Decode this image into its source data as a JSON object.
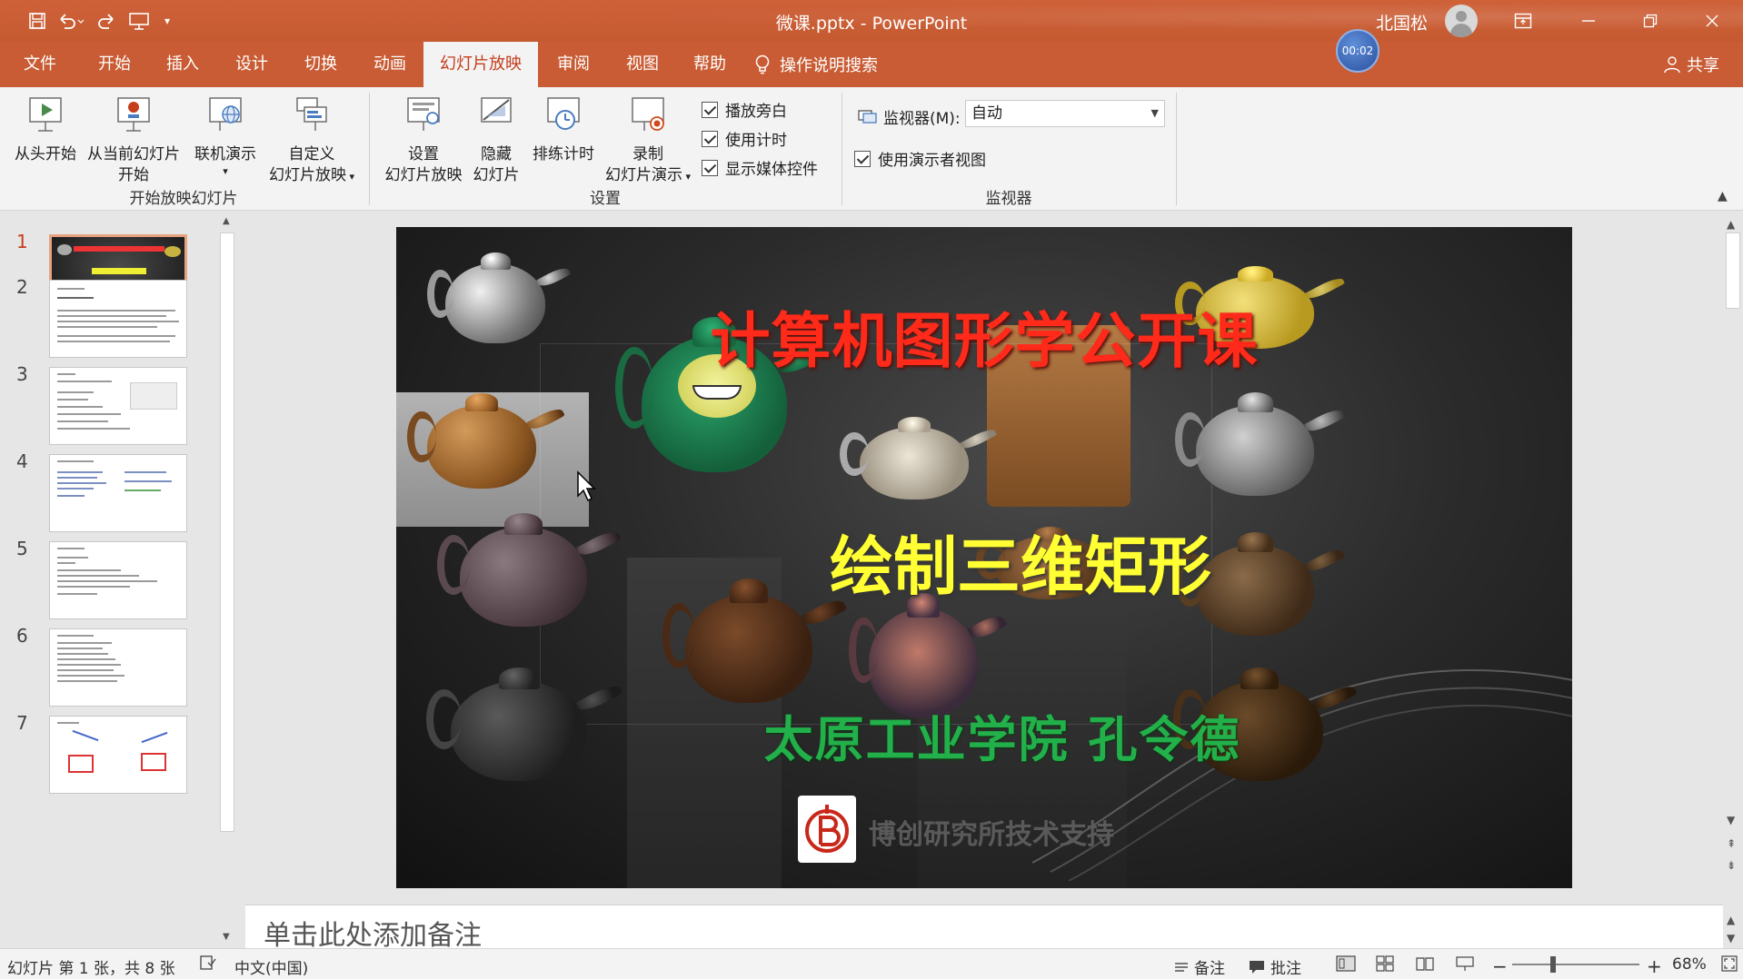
{
  "window": {
    "doc_title": "微课.pptx - PowerPoint",
    "user_name": "北国松",
    "timer": "00:02"
  },
  "tabs": [
    "文件",
    "开始",
    "插入",
    "设计",
    "切换",
    "动画",
    "幻灯片放映",
    "审阅",
    "视图",
    "帮助"
  ],
  "tell_me": "操作说明搜索",
  "share": "共享",
  "ribbon": {
    "start_group": {
      "label": "开始放映幻灯片",
      "from_beginning": "从头开始",
      "from_current_1": "从当前幻灯片",
      "from_current_2": "开始",
      "online": "联机演示",
      "custom_1": "自定义",
      "custom_2": "幻灯片放映"
    },
    "setup_group": {
      "label": "设置",
      "setup_1": "设置",
      "setup_2": "幻灯片放映",
      "hide_1": "隐藏",
      "hide_2": "幻灯片",
      "rehearse": "排练计时",
      "record_1": "录制",
      "record_2": "幻灯片演示",
      "play_narrations": "播放旁白",
      "use_timings": "使用计时",
      "show_media_controls": "显示媒体控件"
    },
    "monitor_group": {
      "label": "监视器",
      "monitor_label": "监视器(M):",
      "monitor_value": "自动",
      "presenter_view": "使用演示者视图"
    }
  },
  "thumbnails": [
    "1",
    "2",
    "3",
    "4",
    "5",
    "6",
    "7"
  ],
  "slide": {
    "title": "计算机图形学公开课",
    "subtitle": "绘制三维矩形",
    "author": "太原工业学院  孔令德",
    "support": "博创研究所技术支持"
  },
  "notes_placeholder": "单击此处添加备注",
  "status": {
    "slide_info": "幻灯片 第 1 张，共 8 张",
    "language": "中文(中国)",
    "notes_btn": "备注",
    "comments_btn": "批注",
    "zoom": "68%"
  },
  "colors": {
    "accent": "#c95c34",
    "active_tab_text": "#c43e1c",
    "title_red": "#ff2a1a",
    "subtitle_yellow": "#ffff33",
    "author_green": "#22b04a"
  }
}
